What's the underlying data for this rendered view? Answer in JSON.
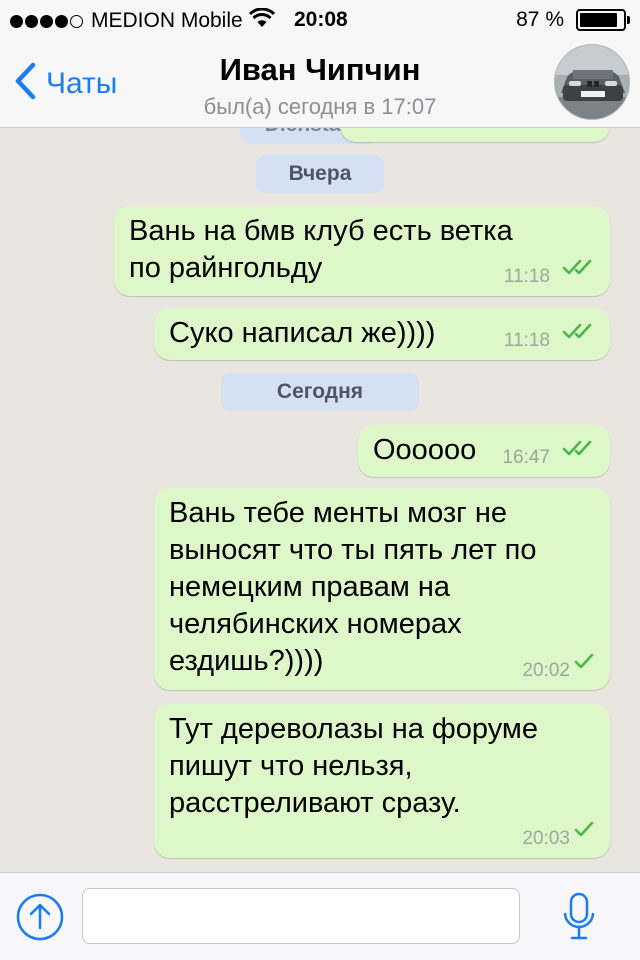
{
  "status_bar": {
    "carrier": "MEDION Mobile",
    "time": "20:08",
    "battery_text": "87 %",
    "battery_level_percent": 87,
    "signal_bars_filled": 4,
    "signal_bars_total": 5,
    "icons": [
      "signal-dots-icon",
      "wifi-icon",
      "battery-icon"
    ]
  },
  "nav": {
    "back_label": "Чаты",
    "contact_name": "Иван Чипчин",
    "last_seen": "был(а) сегодня в 17:07",
    "accent_color": "#1a7cf4"
  },
  "chat": {
    "partial_top_text": "Dienstag",
    "bubble_color": "#ddf7c8",
    "tick_color": "#49b84a",
    "date_separators": [
      {
        "label": "Вчера"
      },
      {
        "label": "Сегодня"
      }
    ],
    "messages": [
      {
        "lines": [
          "Вань на бмв клуб есть ветка",
          "по райнгольду"
        ],
        "time": "11:18",
        "status": "read"
      },
      {
        "lines": [
          "Суко написал же))))"
        ],
        "time": "11:18",
        "status": "read"
      },
      {
        "lines": [
          "Оооооо"
        ],
        "time": "16:47",
        "status": "read"
      },
      {
        "lines": [
          "Вань тебе менты мозг не",
          "выносят что ты пять лет по",
          "немецким правам на",
          "челябинских номерах",
          "ездишь?))))"
        ],
        "time": "20:02",
        "status": "sent"
      },
      {
        "lines": [
          "Тут дереволазы на форуме",
          "пишут что нельзя,",
          "расстреливают сразу."
        ],
        "time": "20:03",
        "status": "sent"
      }
    ]
  },
  "input_bar": {
    "message_value": "",
    "attach_icon": "upload-arrow-icon",
    "mic_icon": "microphone-icon"
  }
}
